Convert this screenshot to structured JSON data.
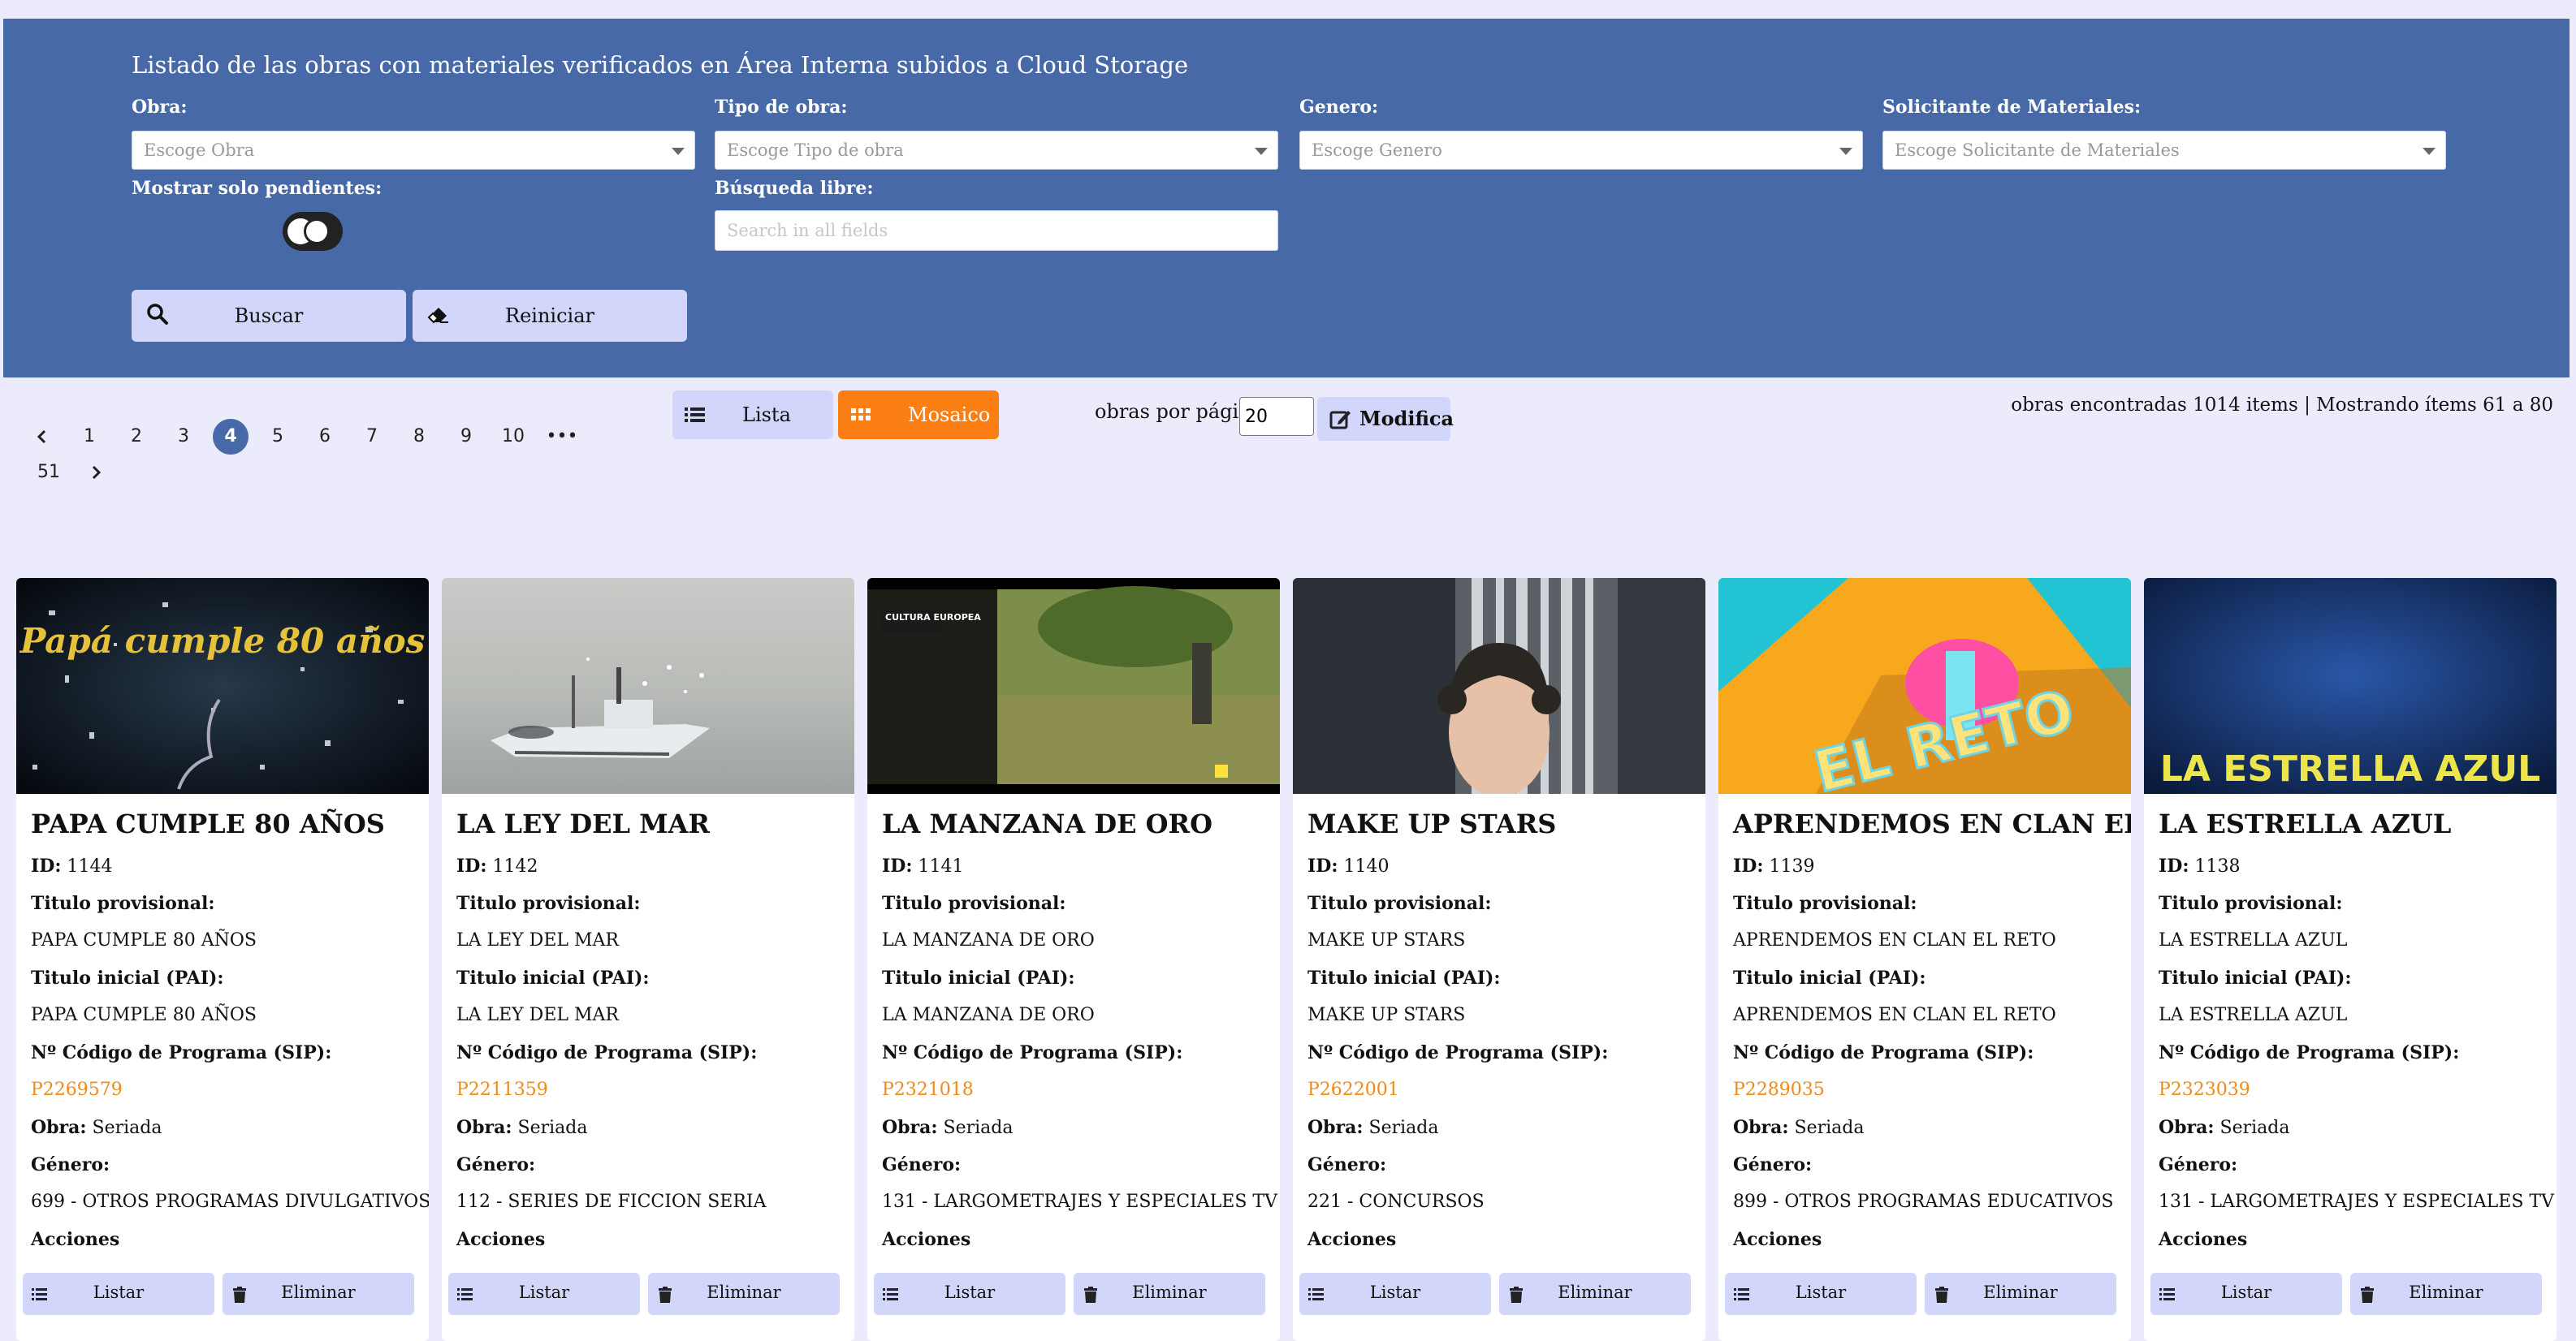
{
  "panel": {
    "title": "Listado de las obras con materiales verificados en Área Interna subidos a Cloud Storage",
    "filters": {
      "obra": {
        "label": "Obra:",
        "placeholder": "Escoge Obra"
      },
      "tipo": {
        "label": "Tipo de obra:",
        "placeholder": "Escoge Tipo de obra"
      },
      "genero": {
        "label": "Genero:",
        "placeholder": "Escoge Genero"
      },
      "solicitante": {
        "label": "Solicitante de Materiales:",
        "placeholder": "Escoge Solicitante de Materiales"
      },
      "pendientes": {
        "label": "Mostrar solo pendientes:",
        "enabled": false
      },
      "busqueda": {
        "label": "Búsqueda libre:",
        "placeholder": "Search in all fields"
      }
    },
    "buttons": {
      "buscar": "Buscar",
      "reiniciar": "Reiniciar"
    }
  },
  "pagination": {
    "prev_icon": "chevron-left-icon",
    "pages": [
      "1",
      "2",
      "3",
      "4",
      "5",
      "6",
      "7",
      "8",
      "9",
      "10"
    ],
    "current": "4",
    "ellipsis": "•••",
    "last": "51",
    "next_icon": "chevron-right-icon"
  },
  "view": {
    "lista": "Lista",
    "mosaico": "Mosaico",
    "active": "Mosaico",
    "accent": "#fb7f14"
  },
  "per_page": {
    "label": "obras por página:",
    "value": "20",
    "button": "Modifica"
  },
  "summary": "obras encontradas 1014 items | Mostrando ítems 61 a 80",
  "labels": {
    "id": "ID:",
    "titulo_provisional": "Titulo provisional:",
    "titulo_inicial": "Titulo inicial (PAI):",
    "codigo": "Nº Código de Programa (SIP):",
    "obra": "Obra:",
    "genero": "Género:",
    "acciones": "Acciones",
    "listar": "Listar",
    "eliminar": "Eliminar"
  },
  "cards": [
    {
      "title": "PAPA CUMPLE 80 AÑOS",
      "id": "1144",
      "titulo_provisional": "PAPA CUMPLE 80 AÑOS",
      "titulo_inicial": "PAPA CUMPLE 80 AÑOS",
      "sip": "P2269579",
      "obra": "Seriada",
      "genero": "699 - OTROS PROGRAMAS DIVULGATIVOS",
      "thumb_text": "Papá cumple 80 años"
    },
    {
      "title": "LA LEY DEL MAR",
      "id": "1142",
      "titulo_provisional": "LA LEY DEL MAR",
      "titulo_inicial": "LA LEY DEL MAR",
      "sip": "P2211359",
      "obra": "Seriada",
      "genero": "112 - SERIES DE FICCION SERIA",
      "thumb_text": ""
    },
    {
      "title": "LA MANZANA DE ORO",
      "id": "1141",
      "titulo_provisional": "LA MANZANA DE ORO",
      "titulo_inicial": "LA MANZANA DE ORO",
      "sip": "P2321018",
      "obra": "Seriada",
      "genero": "131 - LARGOMETRAJES Y ESPECIALES TV",
      "thumb_text": "CULTURA EUROPEA"
    },
    {
      "title": "MAKE UP STARS",
      "id": "1140",
      "titulo_provisional": "MAKE UP STARS",
      "titulo_inicial": "MAKE UP STARS",
      "sip": "P2622001",
      "obra": "Seriada",
      "genero": "221 - CONCURSOS",
      "thumb_text": ""
    },
    {
      "title": "APRENDEMOS EN CLAN EL RETO",
      "id": "1139",
      "titulo_provisional": "APRENDEMOS EN CLAN EL RETO",
      "titulo_inicial": "APRENDEMOS EN CLAN EL RETO",
      "sip": "P2289035",
      "obra": "Seriada",
      "genero": "899 - OTROS PROGRAMAS EDUCATIVOS",
      "thumb_text": "EL RETO"
    },
    {
      "title": "LA ESTRELLA AZUL",
      "id": "1138",
      "titulo_provisional": "LA ESTRELLA AZUL",
      "titulo_inicial": "LA ESTRELLA AZUL",
      "sip": "P2323039",
      "obra": "Seriada",
      "genero": "131 - LARGOMETRAJES Y ESPECIALES TV",
      "thumb_text": "LA ESTRELLA AZUL"
    }
  ]
}
